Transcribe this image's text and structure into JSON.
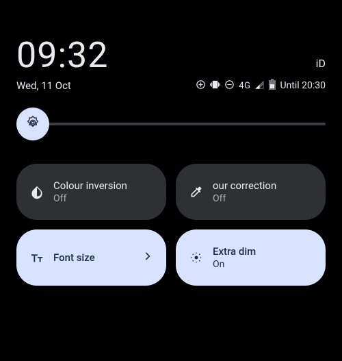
{
  "status": {
    "time": "09:32",
    "carrier": "iD",
    "date": "Wed, 11 Oct",
    "network": "4G",
    "battery_text": "Until 20:30"
  },
  "tiles": {
    "invert": {
      "title": "Colour inversion",
      "sub": "Off"
    },
    "correct": {
      "title": "our correction",
      "sub": "Off"
    },
    "font": {
      "title": "Font size"
    },
    "dim": {
      "title": "Extra dim",
      "sub": "On"
    }
  }
}
